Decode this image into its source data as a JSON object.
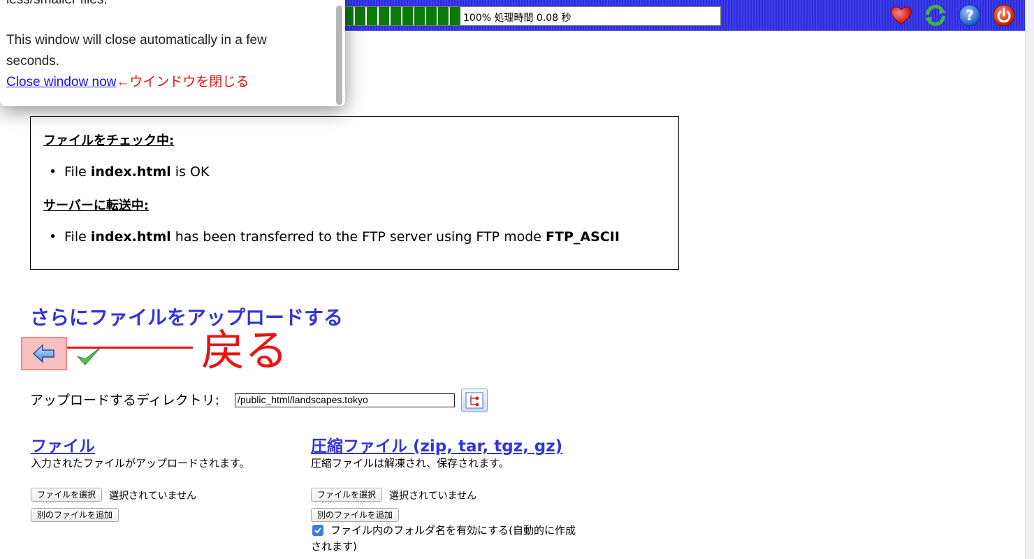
{
  "popup": {
    "line_partial": "less/smaller files.",
    "line1": "This window will close automatically in a few",
    "line2": "seconds.",
    "close_link": "Close window now",
    "close_annotation": "←ウインドウを閉じる"
  },
  "progress": {
    "percent": 100,
    "label": "100% 処理時間 0.08 秒"
  },
  "toolbar": {
    "icons": [
      "heart-icon",
      "refresh-icon",
      "help-icon",
      "power-icon"
    ],
    "colors": {
      "bar": "#2b2be0",
      "progress": "#0a7a0a"
    }
  },
  "status": {
    "checking_heading": "ファイルをチェック中:",
    "check_item_pre": "File ",
    "check_item_file": "index.html",
    "check_item_post": " is OK",
    "transfer_heading": "サーバーに転送中:",
    "transfer_pre": "File ",
    "transfer_file": "index.html",
    "transfer_mid": " has been transferred to the FTP server using FTP mode ",
    "transfer_mode": "FTP_ASCII"
  },
  "main": {
    "upload_more": "さらにファイルをアップロードする",
    "back_annotation": "戻る",
    "dir_label": "アップロードするディレクトリ:",
    "dir_value": "/public_html/landscapes.tokyo"
  },
  "files_col": {
    "title": "ファイル",
    "desc": "入力されたファイルがアップロードされます。",
    "choose_button": "ファイルを選択",
    "no_file": "選択されていません",
    "add_button": "別のファイルを追加"
  },
  "archive_col": {
    "title": "圧縮ファイル (zip, tar, tgz, gz)",
    "desc": "圧縮ファイルは解凍され、保存されます。",
    "choose_button": "ファイルを選択",
    "no_file": "選択されていません",
    "add_button": "別のファイルを追加",
    "checkbox_label_1": "ファイル内のフォルダ名を有効にする(自動的に作成",
    "checkbox_label_2": "されます)",
    "checkbox_checked": true
  }
}
